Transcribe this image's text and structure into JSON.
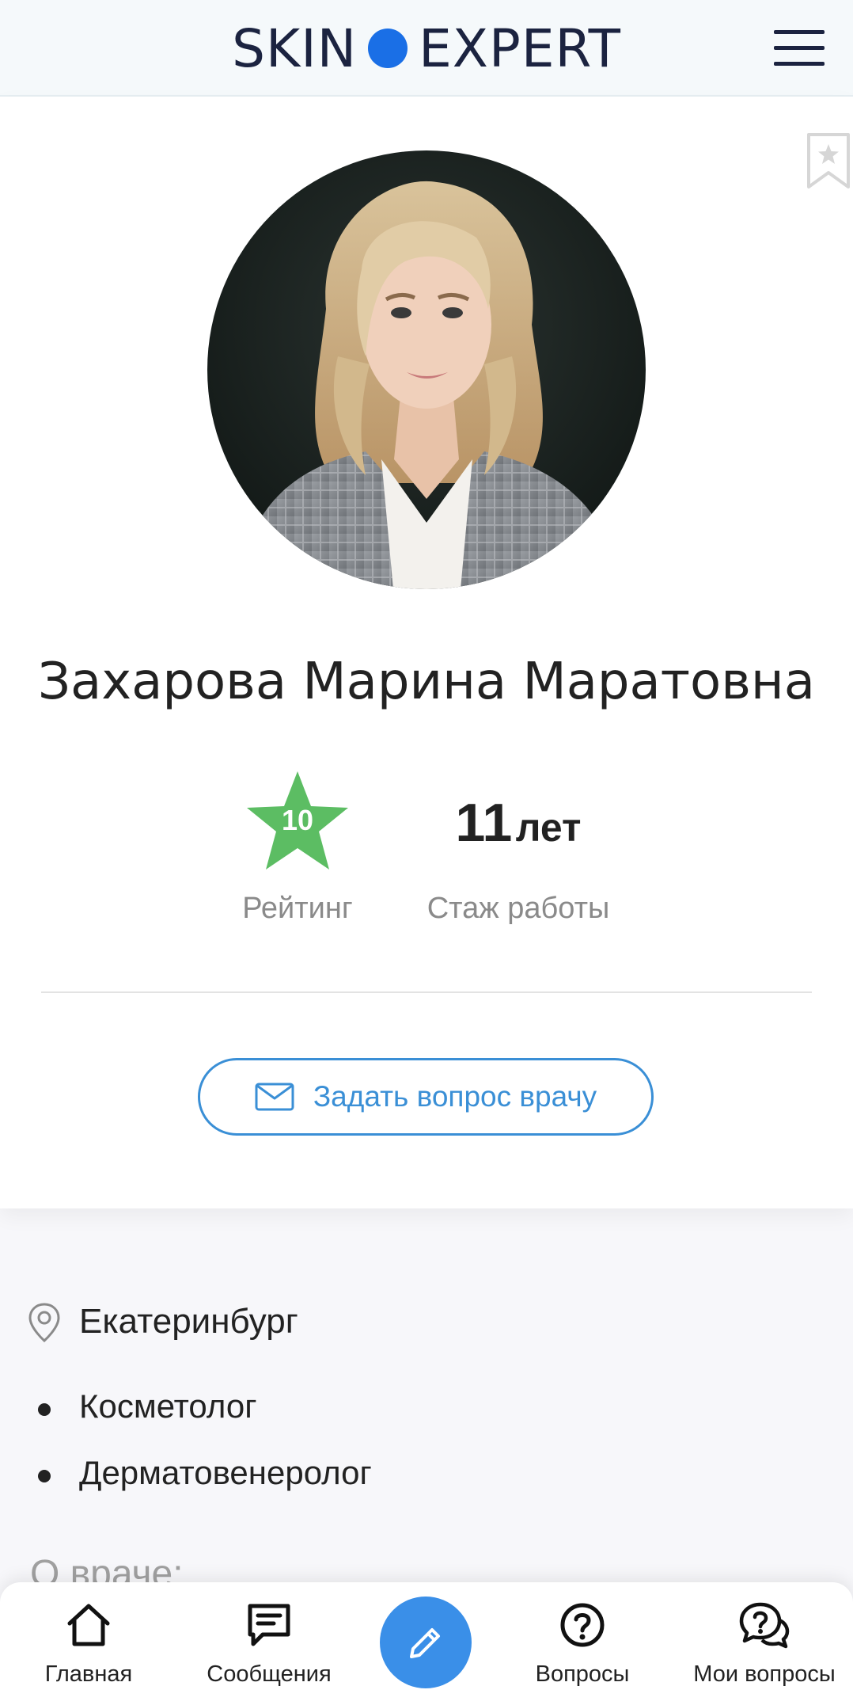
{
  "header": {
    "logo_left": "SKIN",
    "logo_right": "EXPERT",
    "logo_dot_color": "#1a6fe6"
  },
  "profile": {
    "name": "Захарова Марина Маратовна",
    "rating_value": "10",
    "rating_label": "Рейтинг",
    "rating_color": "#5cbd63",
    "experience_number": "11",
    "experience_unit": "лет",
    "experience_label": "Стаж работы",
    "ask_button_label": "Задать вопрос врачу"
  },
  "info": {
    "city": "Екатеринбург",
    "specialties": [
      "Косметолог",
      "Дерматовенеролог"
    ],
    "about_title": "О враче:"
  },
  "bottom_nav": {
    "items": [
      {
        "label": "Главная",
        "icon": "home-icon"
      },
      {
        "label": "Сообщения",
        "icon": "message-icon"
      },
      {
        "label": "Вопросы",
        "icon": "question-icon"
      },
      {
        "label": "Мои вопросы",
        "icon": "my-questions-icon"
      }
    ],
    "fab_icon": "pencil-icon",
    "fab_color": "#3a8fe8"
  },
  "colors": {
    "accent": "#3a8fd6",
    "text_dark": "#222222",
    "text_muted": "#8a8a8a"
  }
}
